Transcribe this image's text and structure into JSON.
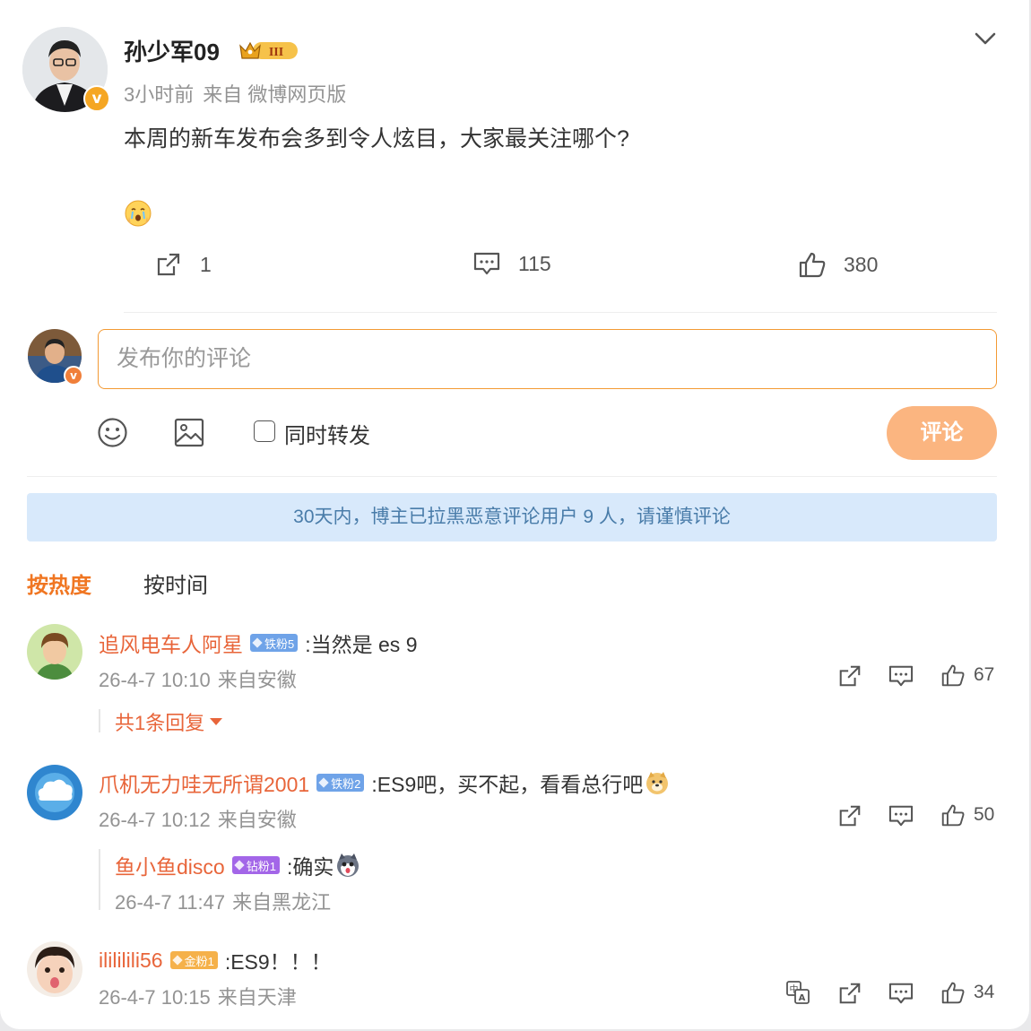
{
  "post": {
    "author": "孙少军09",
    "crown_level": "III",
    "time": "3小时前",
    "source": "来自 微博网页版",
    "text": "本周的新车发布会多到令人炫目，大家最关注哪个?",
    "actions": {
      "repost": "1",
      "comment": "115",
      "like": "380"
    }
  },
  "composer": {
    "placeholder": "发布你的评论",
    "repost_label": "同时转发",
    "submit_label": "评论"
  },
  "notice": "30天内，博主已拉黑恶意评论用户 9 人，请谨慎评论",
  "sort_tabs": {
    "hot": "按热度",
    "time": "按时间"
  },
  "comments": [
    {
      "name": "追风电车人阿星",
      "badge": "铁粉5",
      "text": ":当然是 es 9",
      "time": "26-4-7 10:10",
      "location": "来自安徽",
      "likes": "67",
      "more_replies": "共1条回复"
    },
    {
      "name": "爪机无力哇无所谓2001",
      "badge": "铁粉2",
      "text": ":ES9吧，买不起，看看总行吧",
      "time": "26-4-7 10:12",
      "location": "来自安徽",
      "likes": "50",
      "reply": {
        "name": "鱼小鱼disco",
        "badge": "钻粉1",
        "text": ":确实",
        "time": "26-4-7 11:47",
        "location": "来自黑龙江"
      }
    },
    {
      "name": "ilililili56",
      "badge": "金粉1",
      "text": ":ES9！！！",
      "time": "26-4-7 10:15",
      "location": "来自天津",
      "likes": "34"
    }
  ],
  "colors": {
    "accent": "#f07622",
    "username": "#e8653a",
    "notice_bg": "#d8e9fb",
    "notice_text": "#497ca9",
    "badge_iron": "#6fa3e8",
    "badge_diamond": "#a366e8",
    "badge_gold": "#f5b14a"
  }
}
